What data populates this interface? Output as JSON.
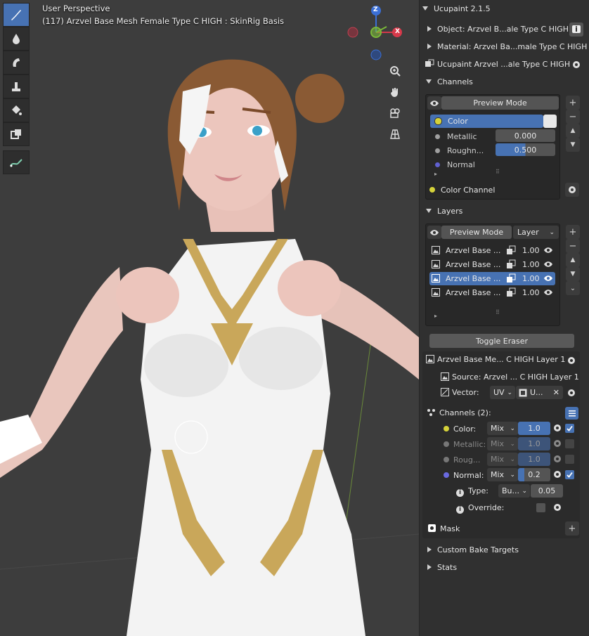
{
  "viewport": {
    "title": "User Perspective",
    "subtitle": "(117) Arzvel Base Mesh Female Type C HIGH : SkinRig Basis",
    "gizmo": {
      "z": "Z",
      "x": "X"
    }
  },
  "panel": {
    "title": "Ucupaint 2.1.5",
    "object_label": "Object: Arzvel B...ale Type C HIGH",
    "material_label": "Material: Arzvel Ba...male Type C HIGH",
    "ucupaint_label": "Ucupaint Arzvel ...ale Type C HIGH",
    "channels_header": "Channels",
    "channels_preview": "Preview Mode",
    "channels": [
      {
        "name": "Color",
        "value": ""
      },
      {
        "name": "Metallic",
        "value": "0.000"
      },
      {
        "name": "Roughn...",
        "value": "0.500"
      },
      {
        "name": "Normal",
        "value": ""
      }
    ],
    "color_channel_label": "Color Channel",
    "layers_header": "Layers",
    "layers_preview": "Preview Mode",
    "layers_dropdown": "Layer",
    "layers": [
      {
        "name": "Arzvel Base ...",
        "value": "1.00"
      },
      {
        "name": "Arzvel Base ...",
        "value": "1.00"
      },
      {
        "name": "Arzvel Base ...",
        "value": "1.00"
      },
      {
        "name": "Arzvel Base ...",
        "value": "1.00"
      }
    ],
    "toggle_eraser": "Toggle Eraser",
    "layer_name": "Arzvel Base Me... C HIGH Layer 1",
    "source_label": "Source: Arzvel ... C HIGH Layer 1",
    "vector_label": "Vector:",
    "vector_uv": "UV",
    "vector_map": "U...",
    "layer_channels_label": "Channels (2):",
    "layer_channels": [
      {
        "name": "Color:",
        "blend": "Mix",
        "value": "1.0"
      },
      {
        "name": "Metallic:",
        "blend": "Mix",
        "value": "1.0"
      },
      {
        "name": "Roug...",
        "blend": "Mix",
        "value": "1.0"
      },
      {
        "name": "Normal:",
        "blend": "Mix",
        "value": "0.2"
      }
    ],
    "type_label": "Type:",
    "type_value": "Bu...",
    "type_number": "0.05",
    "override_label": "Override:",
    "mask_label": "Mask",
    "custom_bake": "Custom Bake Targets",
    "stats": "Stats"
  },
  "colors": {
    "accent": "#4772b3",
    "panel_bg": "#303030",
    "viewport_bg": "#3d3d3d"
  }
}
